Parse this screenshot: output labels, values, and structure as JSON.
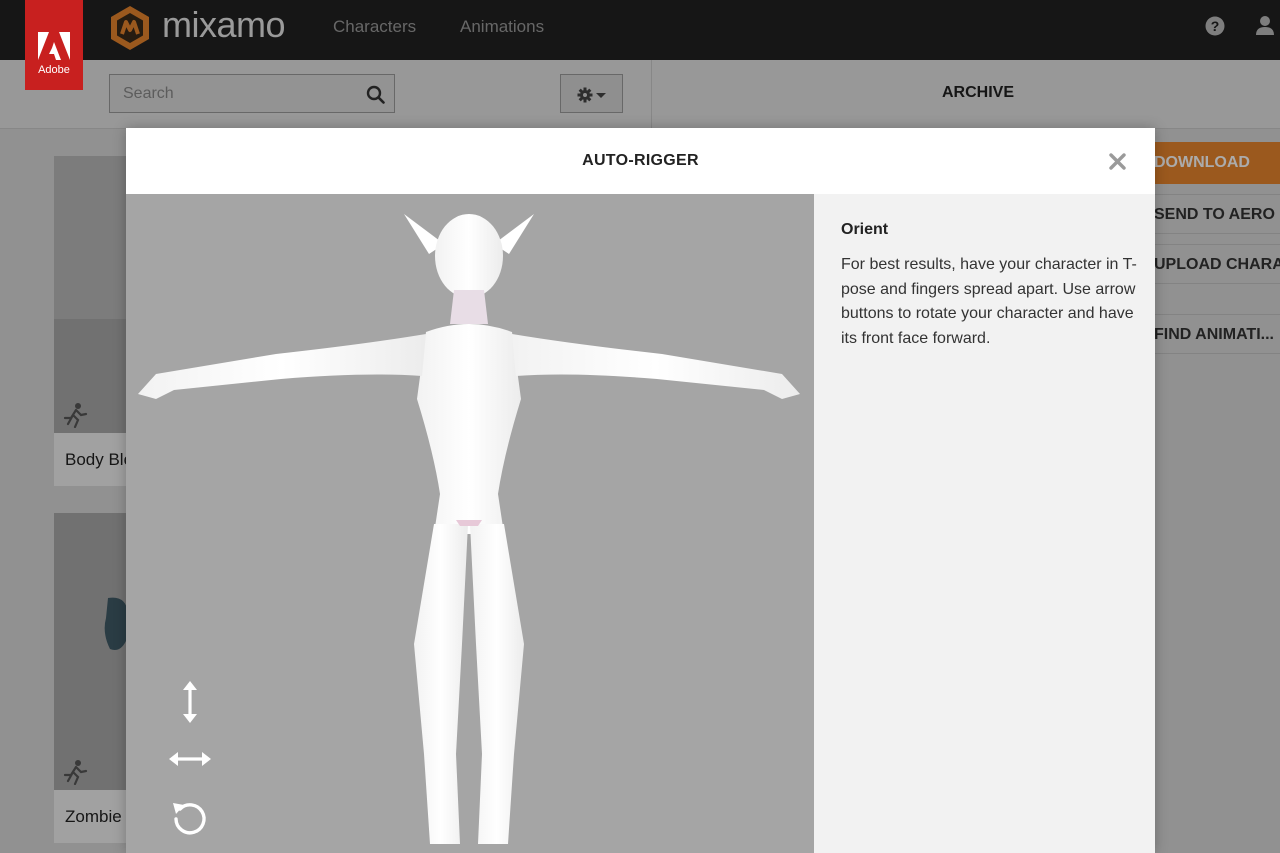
{
  "app": {
    "adobe_label": "Adobe",
    "logo_text": "mixamo",
    "nav": {
      "characters": "Characters",
      "animations": "Animations"
    }
  },
  "toolbar": {
    "search_placeholder": "Search",
    "archive_label": "ARCHIVE"
  },
  "side_panel": {
    "download": "DOWNLOAD",
    "send_to_aero": "SEND TO AERO",
    "upload_character": "UPLOAD CHARACTER",
    "find_animations": "FIND ANIMATI..."
  },
  "cards": [
    {
      "label": "Body Block"
    },
    {
      "label": "Zombie S"
    }
  ],
  "modal": {
    "title": "AUTO-RIGGER",
    "step_title": "Orient",
    "step_text": "For best results, have your character in T-pose and fingers spread apart. Use arrow buttons to rotate your character and have its front face forward."
  },
  "colors": {
    "topbar": "#222222",
    "adobe_red": "#c8201f",
    "download_orange": "#e8852d",
    "viewport_bg": "#a5a5a5"
  },
  "icons": [
    "adobe-icon",
    "mixamo-logo-icon",
    "help-icon",
    "user-icon",
    "search-icon",
    "gear-icon",
    "close-icon",
    "vertical-arrows-icon",
    "horizontal-arrows-icon",
    "rotate-icon",
    "running-figure-icon"
  ]
}
